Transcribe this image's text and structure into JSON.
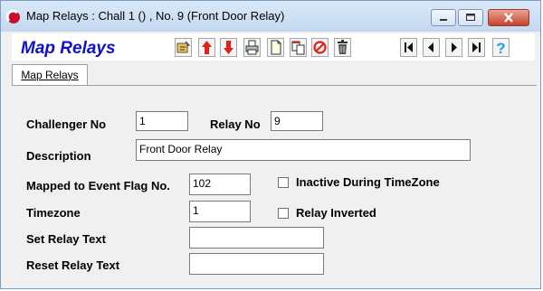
{
  "window": {
    "title": "Map Relays : Chall 1 () , No. 9 (Front Door Relay)"
  },
  "header": {
    "app_title": "Map Relays"
  },
  "toolbar": {
    "icons": [
      "select-icon",
      "move-up-icon",
      "move-down-icon",
      "print-icon",
      "new-icon",
      "copy-icon",
      "cancel-icon",
      "delete-icon",
      "first-record-icon",
      "previous-record-icon",
      "next-record-icon",
      "last-record-icon",
      "help-icon"
    ]
  },
  "tabs": [
    {
      "label": "Map Relays"
    }
  ],
  "form": {
    "challenger_no_label": "Challenger No",
    "challenger_no_value": "1",
    "relay_no_label": "Relay No",
    "relay_no_value": "9",
    "description_label": "Description",
    "description_value": "Front Door Relay",
    "event_flag_label": "Mapped to Event Flag No.",
    "event_flag_value": "102",
    "timezone_label": "Timezone",
    "timezone_value": "1",
    "set_relay_text_label": "Set Relay Text",
    "set_relay_text_value": "",
    "reset_relay_text_label": "Reset Relay Text",
    "reset_relay_text_value": "",
    "inactive_label": "Inactive During TimeZone",
    "inactive_checked": false,
    "inverted_label": "Relay Inverted",
    "inverted_checked": false
  }
}
